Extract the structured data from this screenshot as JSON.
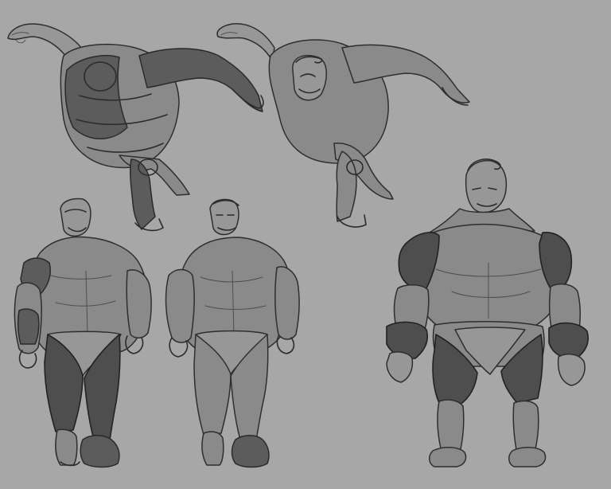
{
  "sheet": {
    "background_color": "#a7a7a7",
    "line_color": "#2c2c2c",
    "shade_color": "#5c5c5c",
    "figures": [
      {
        "id": "running-pose-rough"
      },
      {
        "id": "running-pose-clean"
      },
      {
        "id": "front-walk-rough"
      },
      {
        "id": "front-walk-clean"
      },
      {
        "id": "front-stand-shaded"
      }
    ]
  }
}
